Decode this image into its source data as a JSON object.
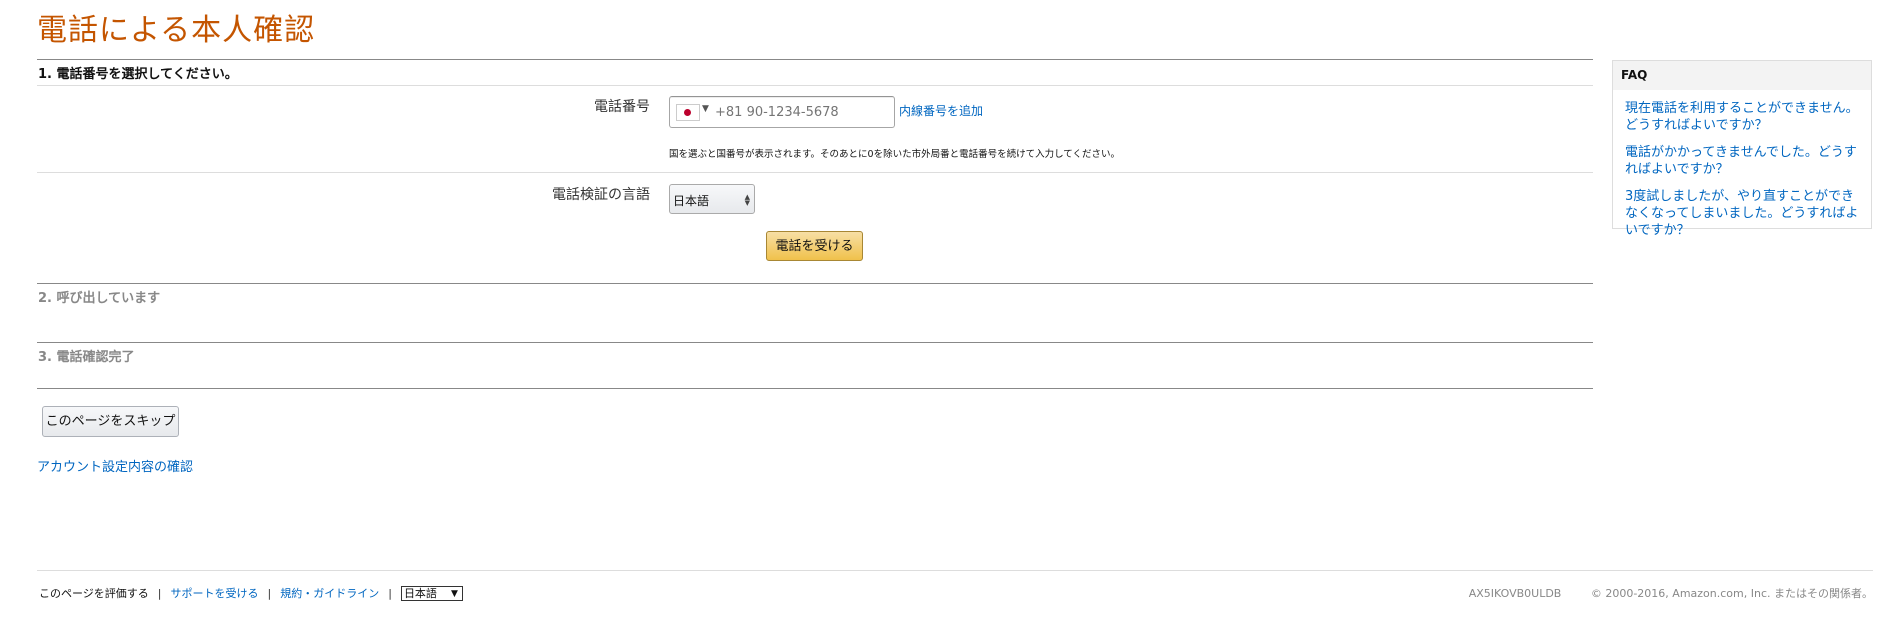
{
  "page": {
    "title": "電話による本人確認"
  },
  "steps": {
    "step1": "1. 電話番号を選択してください。",
    "step2": "2. 呼び出しています",
    "step3": "3. 電話確認完了"
  },
  "phone": {
    "label": "電話番号",
    "placeholder": "+81 90-1234-5678",
    "extension_link": "内線番号を追加",
    "hint": "国を選ぶと国番号が表示されます。そのあとに0を除いた市外局番と電話番号を続けて入力してください。",
    "flag_icon": "japan-flag-icon"
  },
  "language": {
    "label": "電話検証の言語",
    "selected": "日本語"
  },
  "buttons": {
    "call": "電話を受ける",
    "skip": "このページをスキップ"
  },
  "links": {
    "account": "アカウント設定内容の確認"
  },
  "faq": {
    "heading": "FAQ",
    "items": [
      "現在電話を利用することができません。どうすればよいですか？",
      "電話がかかってきませんでした。どうすればよいですか？",
      "3度試しましたが、やり直すことができなくなってしまいました。どうすればよいですか？"
    ]
  },
  "footer": {
    "rate": "このページを評価する",
    "support": "サポートを受ける",
    "guidelines": "規約・ガイドライン",
    "language": "日本語",
    "code": "AX5IKOVB0ULDB",
    "copyright": "© 2000-2016, Amazon.com, Inc. またはその関係者。"
  },
  "colors": {
    "title": "#c45500",
    "link": "#0066c0",
    "primary_button": "#f0c14b"
  }
}
